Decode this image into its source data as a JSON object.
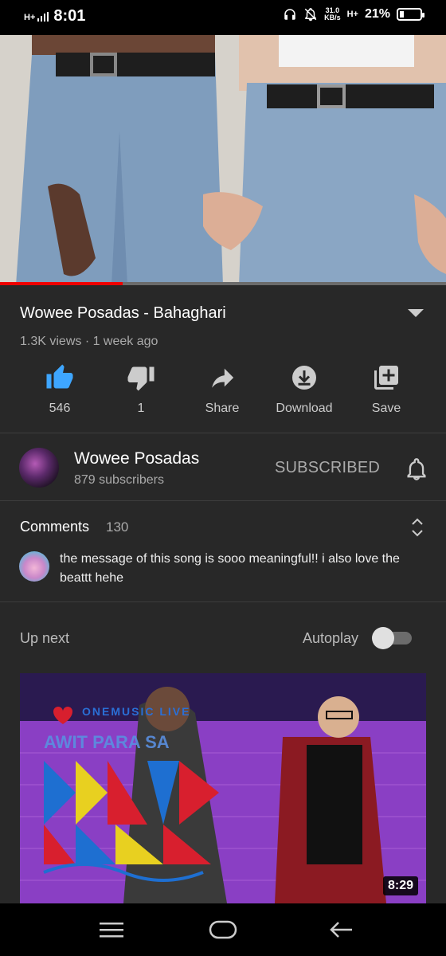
{
  "status_bar": {
    "network": "H+",
    "time": "8:01",
    "speed_value": "31.0",
    "speed_unit": "KB/s",
    "network2": "H+",
    "battery": "21%"
  },
  "player": {
    "progress_fraction": 0.275
  },
  "video": {
    "title": "Wowee Posadas - Bahaghari",
    "meta": "1.3K views · 1 week ago"
  },
  "actions": {
    "like_count": "546",
    "dislike_count": "1",
    "share_label": "Share",
    "download_label": "Download",
    "save_label": "Save"
  },
  "channel": {
    "name": "Wowee Posadas",
    "subscribers": "879 subscribers",
    "subscribe_label": "SUBSCRIBED"
  },
  "comments": {
    "heading": "Comments",
    "count": "130",
    "top_comment": "the message of this song is sooo meaningful!! i also love the beattt hehe"
  },
  "up_next": {
    "label": "Up next",
    "autoplay_label": "Autoplay",
    "autoplay_on": false,
    "thumbnail_brand": "ONEMUSIC LIVE",
    "thumbnail_title": "AWIT PARA SA",
    "duration": "8:29"
  },
  "colors": {
    "accent_like": "#3ea6ff",
    "progress": "#ff0000",
    "panel_bg": "#282828"
  }
}
